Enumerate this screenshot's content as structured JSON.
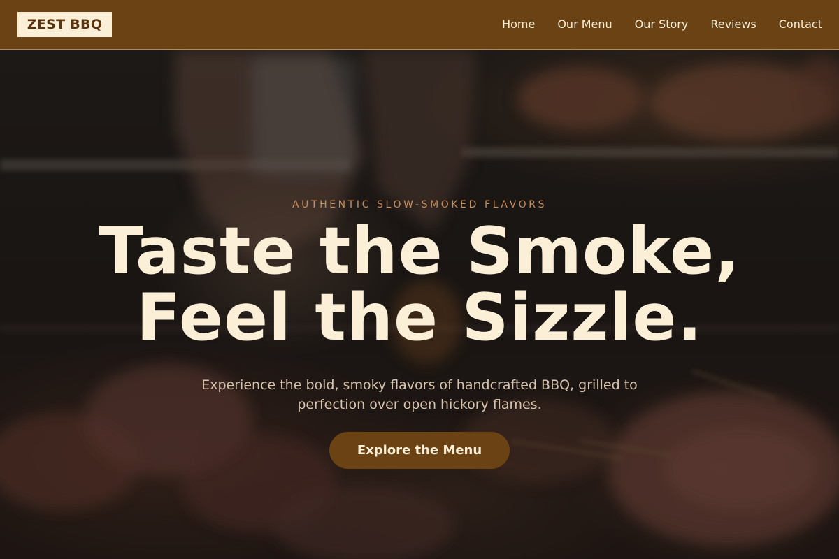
{
  "brand": {
    "logo_text": "ZEST BBQ",
    "primary_color": "#6b4214",
    "cream_color": "#fbefd7",
    "accent_color": "#c98f5b"
  },
  "nav": {
    "items": [
      {
        "label": "Home"
      },
      {
        "label": "Our Menu"
      },
      {
        "label": "Our Story"
      },
      {
        "label": "Reviews"
      },
      {
        "label": "Contact"
      }
    ]
  },
  "hero": {
    "eyebrow": "AUTHENTIC SLOW-SMOKED FLAVORS",
    "headline_line1": "Taste the Smoke,",
    "headline_line2": "Feel the Sizzle.",
    "subtext": "Experience the bold, smoky flavors of handcrafted BBQ, grilled to perfection over open hickory flames.",
    "cta_label": "Explore the Menu"
  }
}
